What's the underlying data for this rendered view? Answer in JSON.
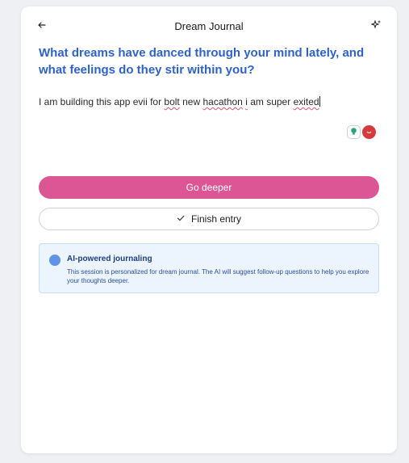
{
  "header": {
    "title": "Dream Journal",
    "back_icon": "arrow-left-icon",
    "action_icon": "sparkles-icon"
  },
  "prompt": "What dreams have danced through your mind lately, and what feelings do they stir within you?",
  "entry": {
    "segments": [
      "I am building this app evii for ",
      "bolt",
      " new ",
      "hacathon",
      " ",
      "i",
      " am super ",
      "exited"
    ]
  },
  "buttons": {
    "deeper_label": "Go deeper",
    "finish_label": "Finish entry",
    "finish_icon": "check-icon"
  },
  "info": {
    "title": "AI-powered journaling",
    "body": "This session is personalized for dream journal. The AI will suggest follow-up questions to help you explore your thoughts deeper."
  },
  "colors": {
    "accent_blue": "#2f62c9",
    "go_deeper_pink": "#dc5595",
    "info_bg": "#ecf4fd"
  }
}
